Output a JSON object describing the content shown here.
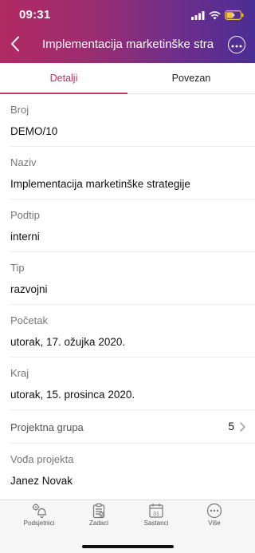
{
  "status_bar": {
    "time": "09:31"
  },
  "nav": {
    "title": "Implementacija marketinške strategije"
  },
  "tabs": [
    {
      "label": "Detalji",
      "active": true
    },
    {
      "label": "Povezan",
      "active": false
    }
  ],
  "fields": [
    {
      "label": "Broj",
      "value": "DEMO/10"
    },
    {
      "label": "Naziv",
      "value": "Implementacija marketinške strategije"
    },
    {
      "label": "Podtip",
      "value": "interni"
    },
    {
      "label": "Tip",
      "value": "razvojni"
    },
    {
      "label": "Početak",
      "value": "utorak, 17. ožujka 2020."
    },
    {
      "label": "Kraj",
      "value": "utorak, 15. prosinca 2020."
    }
  ],
  "project_group": {
    "label": "Projektna grupa",
    "count": "5"
  },
  "project_lead": {
    "label": "Vođa projekta",
    "value": "Janez Novak"
  },
  "tabbar": {
    "items": [
      {
        "label": "Podsjetnici",
        "icon": "bell-gear-icon"
      },
      {
        "label": "Zadaci",
        "icon": "clipboard-icon"
      },
      {
        "label": "Sastanci",
        "icon": "calendar-icon",
        "day": "31"
      },
      {
        "label": "Više",
        "icon": "more-icon"
      }
    ]
  },
  "colors": {
    "header_gradient_start": "#b12a63",
    "header_gradient_end": "#4a2e96",
    "accent": "#c23a61",
    "battery": "#f5c242"
  }
}
